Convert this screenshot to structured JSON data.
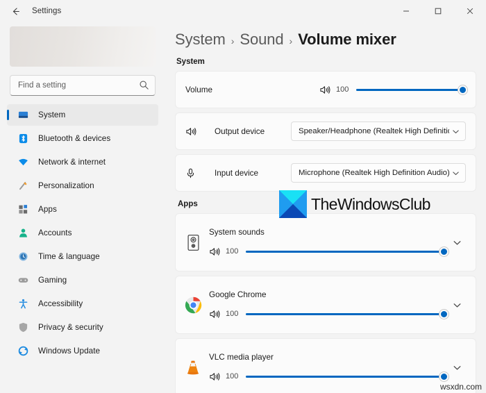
{
  "window": {
    "app_title": "Settings",
    "back_icon": "arrow-left-icon",
    "controls": [
      {
        "name": "minimize-button",
        "glyph": "minimize-icon"
      },
      {
        "name": "maximize-button",
        "glyph": "maximize-icon"
      },
      {
        "name": "close-button",
        "glyph": "close-icon"
      }
    ]
  },
  "sidebar": {
    "search": {
      "placeholder": "Find a setting",
      "value": "",
      "icon": "search-icon"
    },
    "items": [
      {
        "label": "System",
        "icon": "monitor-icon",
        "selected": true
      },
      {
        "label": "Bluetooth & devices",
        "icon": "bluetooth-icon",
        "selected": false
      },
      {
        "label": "Network & internet",
        "icon": "wifi-icon",
        "selected": false
      },
      {
        "label": "Personalization",
        "icon": "paintbrush-icon",
        "selected": false
      },
      {
        "label": "Apps",
        "icon": "apps-grid-icon",
        "selected": false
      },
      {
        "label": "Accounts",
        "icon": "person-icon",
        "selected": false
      },
      {
        "label": "Time & language",
        "icon": "clock-icon",
        "selected": false
      },
      {
        "label": "Gaming",
        "icon": "gamepad-icon",
        "selected": false
      },
      {
        "label": "Accessibility",
        "icon": "accessibility-icon",
        "selected": false
      },
      {
        "label": "Privacy & security",
        "icon": "shield-icon",
        "selected": false
      },
      {
        "label": "Windows Update",
        "icon": "update-icon",
        "selected": false
      }
    ]
  },
  "breadcrumb": {
    "root": "System",
    "middle": "Sound",
    "current": "Volume mixer",
    "separator": "›"
  },
  "system_section": {
    "label": "System",
    "volume_row": {
      "label": "Volume",
      "value": "100",
      "percent": 100,
      "icon": "speaker-icon"
    },
    "output_row": {
      "label": "Output device",
      "icon": "speaker-icon",
      "selected": "Speaker/Headphone (Realtek High Definitio",
      "chevron": "chevron-down-icon"
    },
    "input_row": {
      "label": "Input device",
      "icon": "microphone-icon",
      "selected": "Microphone (Realtek High Definition Audio)",
      "chevron": "chevron-down-icon"
    }
  },
  "apps_section": {
    "label": "Apps",
    "apps": [
      {
        "name": "System sounds",
        "icon": "speaker-box-icon",
        "value": "100",
        "percent": 100,
        "expand": "chevron-down-icon"
      },
      {
        "name": "Google Chrome",
        "icon": "chrome-icon",
        "value": "100",
        "percent": 100,
        "expand": "chevron-down-icon"
      },
      {
        "name": "VLC media player",
        "icon": "vlc-cone-icon",
        "value": "100",
        "percent": 100,
        "expand": "chevron-down-icon"
      }
    ]
  },
  "watermarks": {
    "brand_text": "TheWindowsClub",
    "brand_logo": "thewindowsclub-logo-icon",
    "corner_text": "wsxdn.com"
  },
  "colors": {
    "accent": "#0067c0",
    "card_bg": "#fbfbfb",
    "page_bg": "#f3f3f3",
    "selected_nav": "#e9e9e9"
  }
}
